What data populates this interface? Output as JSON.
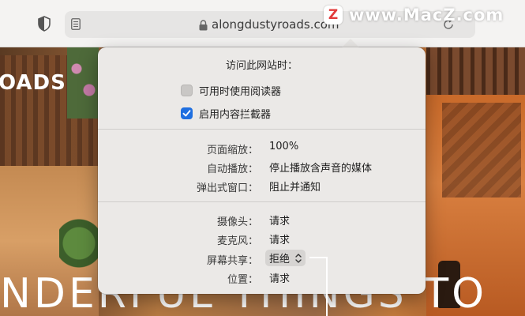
{
  "toolbar": {
    "url": "alongdustyroads.com"
  },
  "watermark": {
    "badge": "Z",
    "text": "www.MacZ.com"
  },
  "background": {
    "title_left": "OADS",
    "title_bottom": "NDERFUL THINGS TO"
  },
  "popover": {
    "title": "访问此网站时：",
    "checkboxes": [
      {
        "label": "可用时使用阅读器",
        "checked": false
      },
      {
        "label": "启用内容拦截器",
        "checked": true
      }
    ],
    "general": [
      {
        "label": "页面缩放：",
        "value": "100%"
      },
      {
        "label": "自动播放：",
        "value": "停止播放含声音的媒体"
      },
      {
        "label": "弹出式窗口：",
        "value": "阻止并通知"
      }
    ],
    "permissions": [
      {
        "label": "摄像头：",
        "value": "请求"
      },
      {
        "label": "麦克风：",
        "value": "请求"
      },
      {
        "label": "屏幕共享：",
        "value": "拒绝"
      },
      {
        "label": "位置：",
        "value": "请求"
      }
    ]
  },
  "colors": {
    "accent": "#1f6fe0",
    "popover_bg": "#ebe9e7"
  }
}
